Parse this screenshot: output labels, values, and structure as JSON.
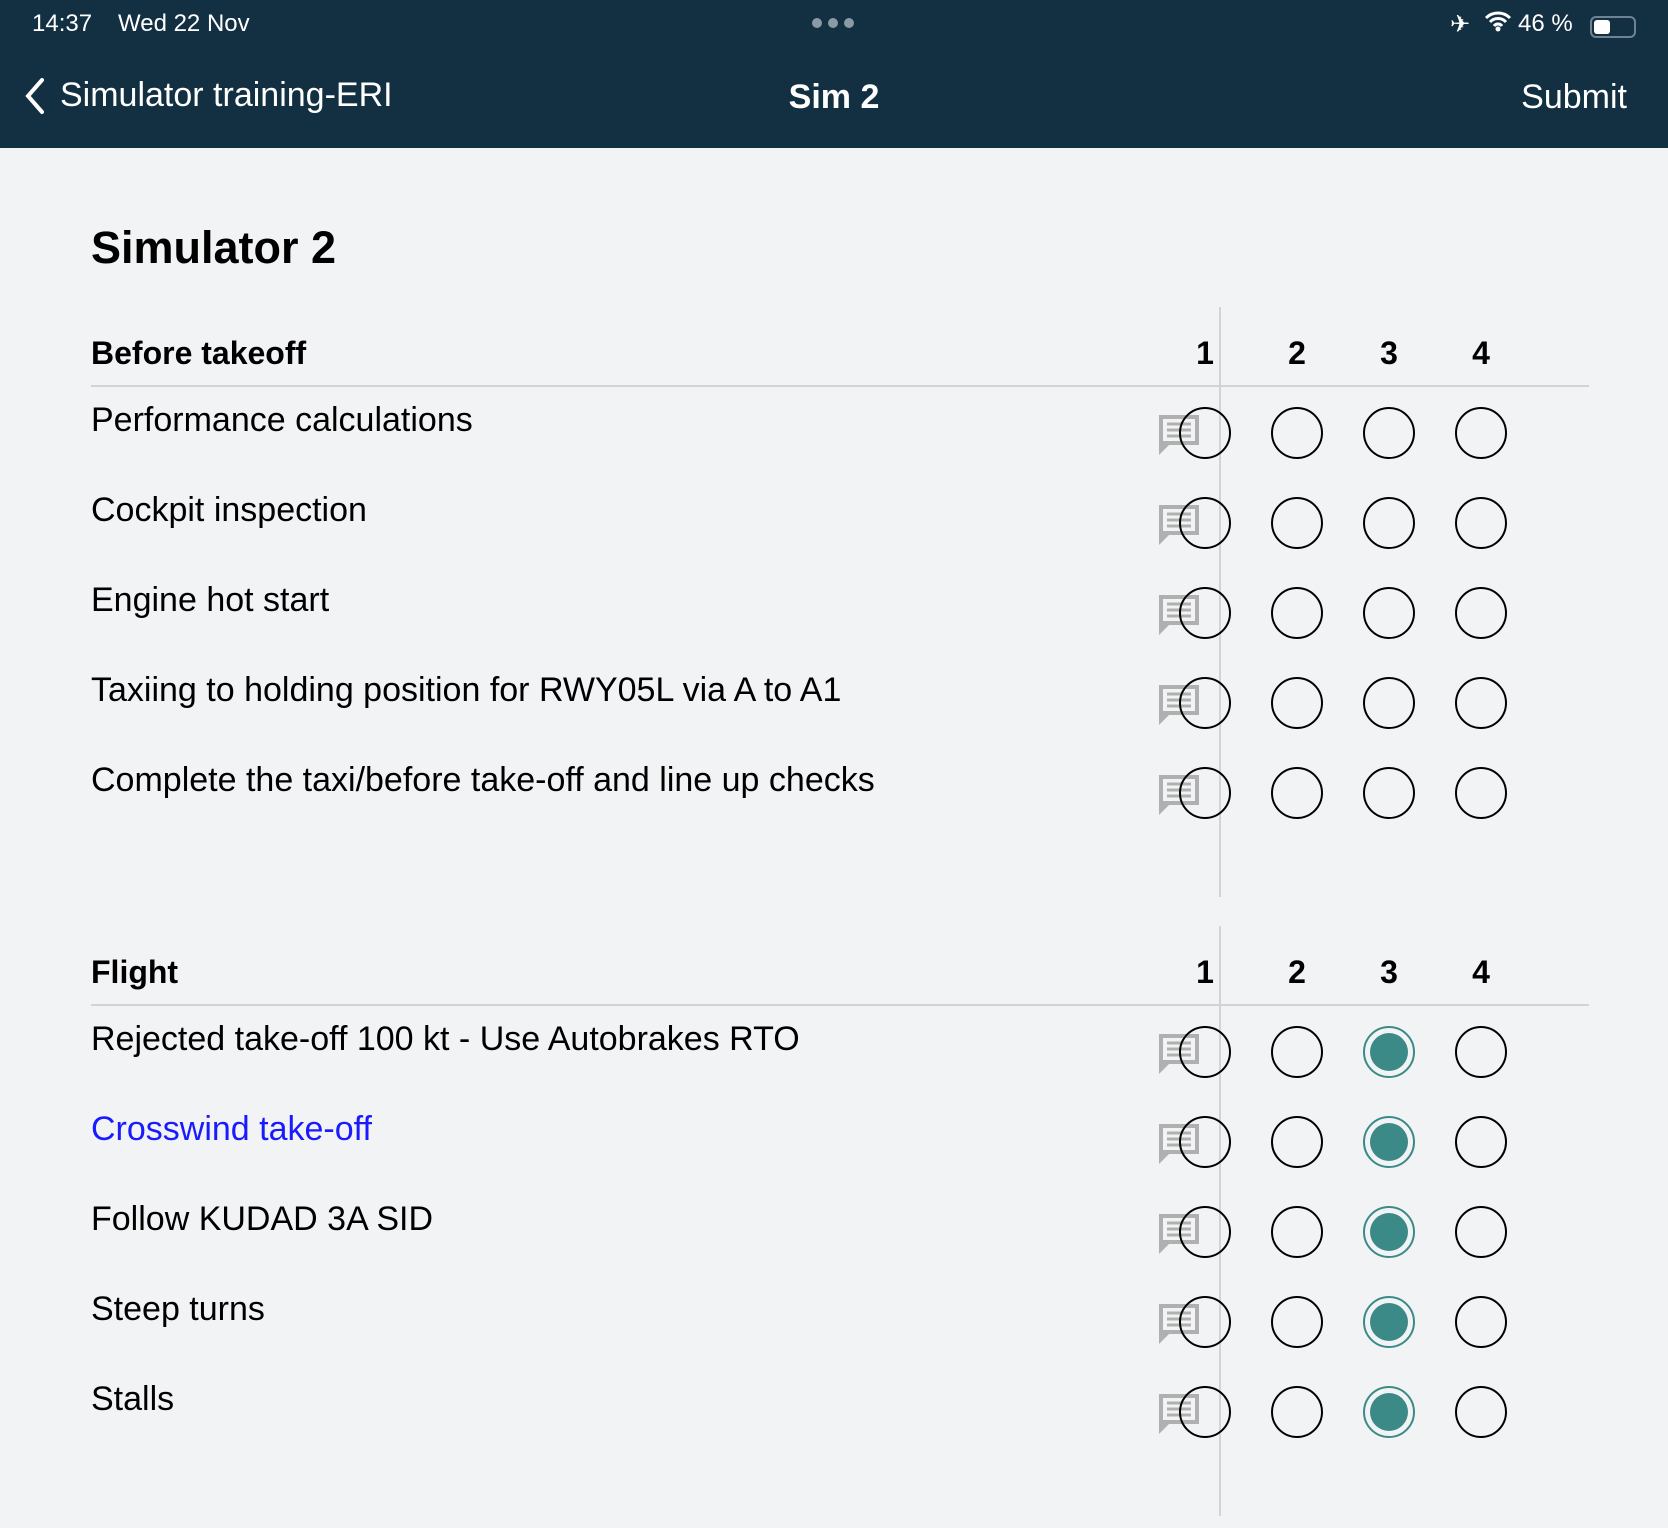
{
  "status_bar": {
    "time": "14:37",
    "date": "Wed 22 Nov",
    "battery": "46 %",
    "battery_level": 0.46
  },
  "nav": {
    "back_label": "Simulator training-ERI",
    "title": "Sim 2",
    "submit_label": "Submit"
  },
  "page_title": "Simulator 2",
  "colors": {
    "accent": "#3b8a88",
    "header_bg": "#133042",
    "link": "#1a1aff"
  },
  "sections": [
    {
      "name": "Before takeoff",
      "columns": [
        "1",
        "2",
        "3",
        "4"
      ],
      "rows": [
        {
          "label": "Performance calculations",
          "selected": null
        },
        {
          "label": "Cockpit inspection",
          "selected": null
        },
        {
          "label": "Engine hot start",
          "selected": null
        },
        {
          "label": "Taxiing to holding position for RWY05L via A to A1",
          "selected": null
        },
        {
          "label": "Complete the taxi/before take-off and line up checks",
          "selected": null
        }
      ]
    },
    {
      "name": "Flight",
      "columns": [
        "1",
        "2",
        "3",
        "4"
      ],
      "rows": [
        {
          "label": "Rejected take-off 100 kt - Use Autobrakes RTO",
          "selected": 3
        },
        {
          "label": "Crosswind take-off",
          "selected": 3,
          "highlight": true
        },
        {
          "label": "Follow KUDAD 3A SID",
          "selected": 3
        },
        {
          "label": "Steep turns",
          "selected": 3
        },
        {
          "label": "Stalls",
          "selected": 3
        }
      ]
    }
  ]
}
